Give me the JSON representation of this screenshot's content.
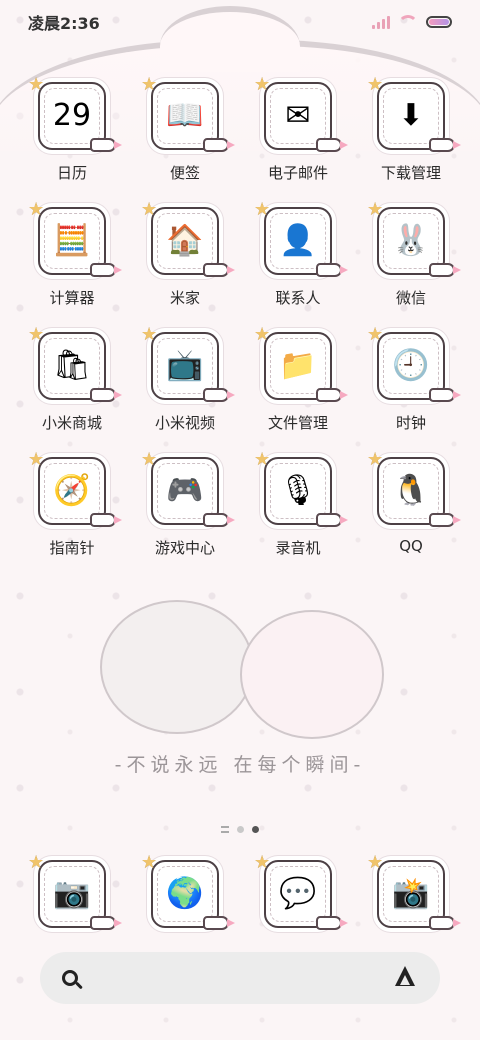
{
  "status_bar": {
    "time": "凌晨2:36"
  },
  "apps": [
    {
      "label": "日历",
      "icon": "calendar-icon",
      "glyph": "29"
    },
    {
      "label": "便签",
      "icon": "notes-icon",
      "glyph": "📖"
    },
    {
      "label": "电子邮件",
      "icon": "email-icon",
      "glyph": "✉"
    },
    {
      "label": "下载管理",
      "icon": "download-icon",
      "glyph": "⬇"
    },
    {
      "label": "计算器",
      "icon": "calculator-icon",
      "glyph": "🧮"
    },
    {
      "label": "米家",
      "icon": "mijia-icon",
      "glyph": "🏠"
    },
    {
      "label": "联系人",
      "icon": "contacts-icon",
      "glyph": "👤"
    },
    {
      "label": "微信",
      "icon": "wechat-icon",
      "glyph": "🐰"
    },
    {
      "label": "小米商城",
      "icon": "mi-store-icon",
      "glyph": "🛍"
    },
    {
      "label": "小米视频",
      "icon": "mi-video-icon",
      "glyph": "📺"
    },
    {
      "label": "文件管理",
      "icon": "file-manager-icon",
      "glyph": "📁"
    },
    {
      "label": "时钟",
      "icon": "clock-icon",
      "glyph": "🕘"
    },
    {
      "label": "指南针",
      "icon": "compass-icon",
      "glyph": "🧭"
    },
    {
      "label": "游戏中心",
      "icon": "game-center-icon",
      "glyph": "🎮"
    },
    {
      "label": "录音机",
      "icon": "recorder-icon",
      "glyph": "🎙"
    },
    {
      "label": "QQ",
      "icon": "qq-icon",
      "glyph": "🐧"
    }
  ],
  "widget": {
    "caption": "-不说永远 在每个瞬间-"
  },
  "page_indicator": {
    "pages": 2,
    "active": 2
  },
  "dock": [
    {
      "icon": "camera-bag-icon",
      "glyph": "📷"
    },
    {
      "icon": "browser-globe-icon",
      "glyph": "🌍"
    },
    {
      "icon": "messages-icon",
      "glyph": "💬"
    },
    {
      "icon": "camera-icon",
      "glyph": "📸"
    }
  ],
  "colors": {
    "accent_pink": "#f6a9c0",
    "outline": "#4c4045",
    "background": "#fbf5f6"
  }
}
